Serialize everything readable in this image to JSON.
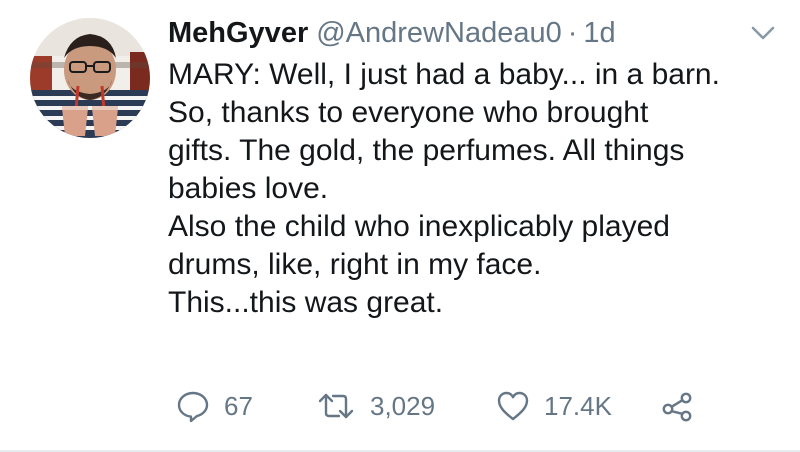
{
  "tweet": {
    "author": {
      "display_name": "MehGyver",
      "handle": "@AndrewNadeau0",
      "separator": "·",
      "timestamp": "1d"
    },
    "text_lines": [
      "MARY: Well, I just had a baby... in a barn.",
      "So, thanks to everyone who brought",
      "gifts. The gold, the perfumes. All things",
      "babies love.",
      "Also the child who inexplicably played",
      "drums, like, right in my face.",
      "This...this was great."
    ],
    "actions": {
      "reply": {
        "icon": "speech-bubble-icon",
        "count": "67"
      },
      "retweet": {
        "icon": "retweet-arrows-icon",
        "count": "3,029"
      },
      "like": {
        "icon": "heart-outline-icon",
        "count": "17.4K"
      },
      "share": {
        "icon": "share-nodes-icon"
      }
    },
    "menu_icon": "chevron-down-icon",
    "colors": {
      "primary_text": "#14171a",
      "secondary_text": "#657786",
      "divider": "#e6ecf0"
    }
  }
}
